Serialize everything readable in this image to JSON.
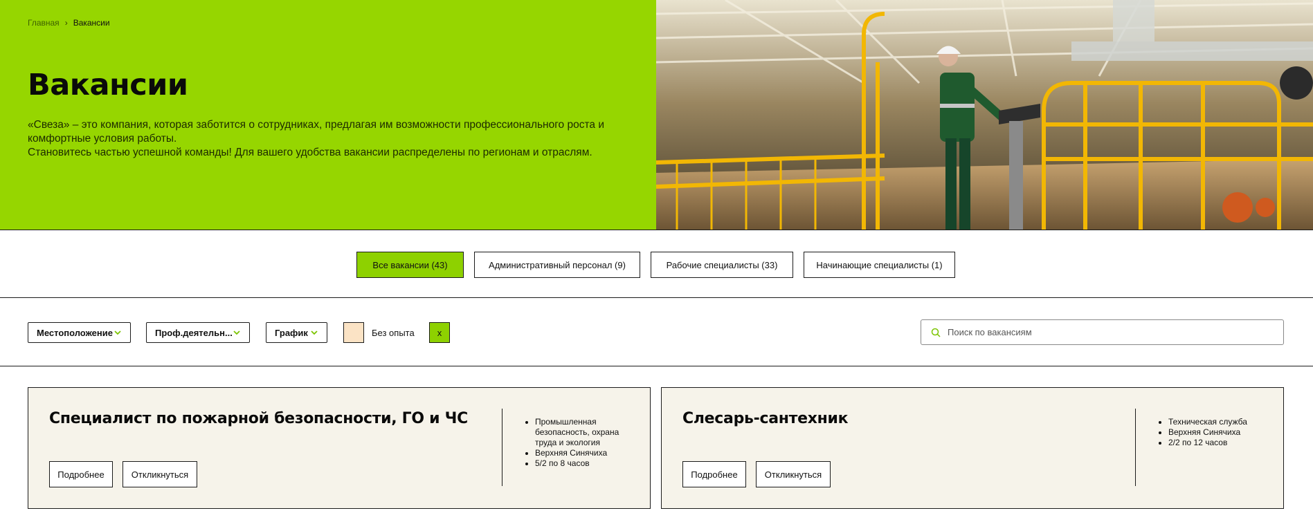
{
  "breadcrumb": {
    "home": "Главная",
    "separator": "›",
    "current": "Вакансии"
  },
  "hero": {
    "title": "Вакансии",
    "desc_line1": "«Свеза» – это компания, которая заботится о сотрудниках, предлагая им возможности профессионального роста и комфортные условия работы.",
    "desc_line2": "Становитесь частью успешной команды! Для вашего удобства вакансии распределены по регионам и отраслям."
  },
  "tabs": [
    {
      "label": "Все вакансии (43)",
      "active": true
    },
    {
      "label": "Административный персонал (9)",
      "active": false
    },
    {
      "label": "Рабочие специалисты (33)",
      "active": false
    },
    {
      "label": "Начинающие специалисты (1)",
      "active": false
    }
  ],
  "filters": {
    "location": "Местоположение",
    "activity": "Проф.деятельн...",
    "schedule": "График",
    "no_experience_label": "Без опыта",
    "clear_label": "x",
    "search_placeholder": "Поиск по вакансиям"
  },
  "vacancies": [
    {
      "title": "Специалист по пожарной безопасности, ГО и ЧС",
      "details_label": "Подробнее",
      "apply_label": "Откликнуться",
      "meta": [
        "Промышленная безопасность, охрана труда и экология",
        "Верхняя Синячиха",
        "5/2 по 8 часов"
      ]
    },
    {
      "title": "Слесарь-сантехник",
      "details_label": "Подробнее",
      "apply_label": "Откликнуться",
      "meta": [
        "Техническая служба",
        "Верхняя Синячиха",
        "2/2 по 12 часов"
      ]
    }
  ],
  "colors": {
    "accent": "#96d600",
    "card_bg": "#f6f3ea",
    "checkbox_bg": "#fbe3c5"
  },
  "icons": {
    "chevron": "chevron-down-icon",
    "search": "search-icon"
  }
}
